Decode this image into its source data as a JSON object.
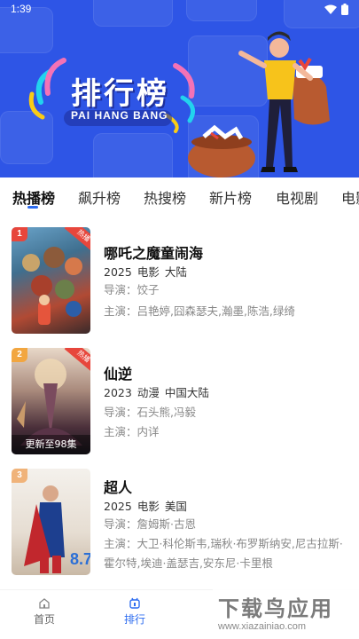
{
  "status": {
    "time": "1:39"
  },
  "banner": {
    "title": "排行榜",
    "subtitle": "PAI HANG BANG"
  },
  "tabs": [
    {
      "label": "热播榜",
      "active": true
    },
    {
      "label": "飙升榜",
      "active": false
    },
    {
      "label": "热搜榜",
      "active": false
    },
    {
      "label": "新片榜",
      "active": false
    },
    {
      "label": "电视剧",
      "active": false
    },
    {
      "label": "电影",
      "active": false
    }
  ],
  "items": [
    {
      "rank": "1",
      "rank_color": "#e7463c",
      "hot": "热播",
      "title": "哪吒之魔童闹海",
      "year": "2025",
      "type": "电影",
      "region": "大陆",
      "director": "导演：饺子",
      "actors": "主演：吕艳婷,囧森瑟夫,瀚墨,陈浩,绿绮"
    },
    {
      "rank": "2",
      "rank_color": "#f2a640",
      "hot": "热播",
      "update": "更新至98集",
      "title": "仙逆",
      "year": "2023",
      "type": "动漫",
      "region": "中国大陆",
      "director": "导演：石头熊,冯毅",
      "actors": "主演：内详"
    },
    {
      "rank": "3",
      "rank_color": "#f0b37a",
      "title": "超人",
      "year": "2025",
      "type": "电影",
      "region": "美国",
      "director": "导演：詹姆斯·古恩",
      "actors": "主演：大卫·科伦斯韦,瑞秋·布罗斯纳安,尼古拉斯·霍尔特,埃迪·盖瑟吉,安东尼·卡里根"
    }
  ],
  "nav": {
    "home": "首页",
    "rank": "排行"
  },
  "watermark": {
    "title": "下载鸟应用",
    "url": "www.xiazainiao.com"
  },
  "colors": {
    "banner": "#2e55e6",
    "accent": "#2d6cf0",
    "hot": "#e7463c"
  }
}
